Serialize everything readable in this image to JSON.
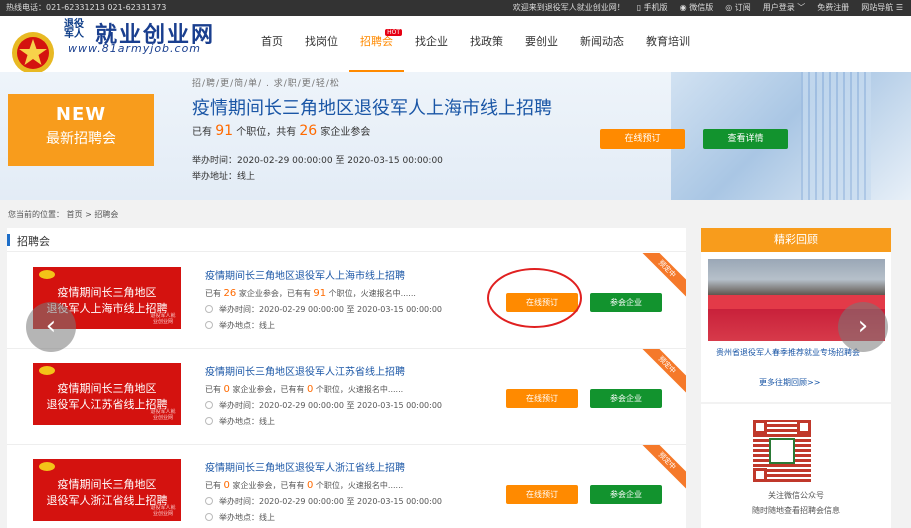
{
  "topbar": {
    "hotline": "热线电话：021-62331213 021-62331373",
    "welcome": "欢迎来到退役军人就业创业网！",
    "mobile": "手机版",
    "wechat": "微信版",
    "subscribe": "订阅",
    "login": "用户登录",
    "register": "免费注册",
    "sitenav": "网站导航"
  },
  "logo": {
    "line1": "退役军人",
    "line2": "就业创业网",
    "url": "www.81armyjob.com"
  },
  "nav": {
    "items": [
      "首页",
      "找岗位",
      "招聘会",
      "找企业",
      "找政策",
      "要创业",
      "新闻动态",
      "教育培训"
    ],
    "hot_badge": "HOT"
  },
  "banner": {
    "new_label": "NEW",
    "new_sub": "最新招聘会",
    "slogan": "招/聘/更/简/单/ . 求/职/更/轻/松",
    "title": "疫情期间长三角地区退役军人上海市线上招聘",
    "count_prefix": "已有",
    "positions": "91",
    "count_mid": "个职位，共有",
    "companies": "26",
    "count_suffix": "家企业参会",
    "time": "举办时间：2020-02-29 00:00:00 至 2020-03-15 00:00:00",
    "address": "举办地址：线上",
    "btn_book": "在线预订",
    "btn_detail": "查看详情"
  },
  "breadcrumb": "您当前的位置： 首页 > 招聘会",
  "section_title": "招聘会",
  "fairs": [
    {
      "thumb_l1": "疫情期间长三角地区",
      "thumb_l2": "退役军人上海市线上招聘",
      "thumb_mark": "退役军人就业创业网",
      "title": "疫情期间长三角地区退役军人上海市线上招聘",
      "p1": "已有 ",
      "n1": "26",
      "p2": " 家企业参会，已有有 ",
      "n2": "91",
      "p3": " 个职位，火速报名中......",
      "time": "举办时间：2020-02-29 00:00:00 至 2020-03-15 00:00:00",
      "addr": "举办地点：线上",
      "btn_book": "在线预订",
      "btn_join": "参会企业",
      "ribbon": "预定中"
    },
    {
      "thumb_l1": "疫情期间长三角地区",
      "thumb_l2": "退役军人江苏省线上招聘",
      "thumb_mark": "退役军人就业创业网",
      "title": "疫情期间长三角地区退役军人江苏省线上招聘",
      "p1": "已有 ",
      "n1": "0",
      "p2": " 家企业参会，已有有 ",
      "n2": "0",
      "p3": " 个职位，火速报名中......",
      "time": "举办时间：2020-02-29 00:00:00 至 2020-03-15 00:00:00",
      "addr": "举办地点：线上",
      "btn_book": "在线预订",
      "btn_join": "参会企业",
      "ribbon": "预定中"
    },
    {
      "thumb_l1": "疫情期间长三角地区",
      "thumb_l2": "退役军人浙江省线上招聘",
      "thumb_mark": "退役军人就业创业网",
      "title": "疫情期间长三角地区退役军人浙江省线上招聘",
      "p1": "已有 ",
      "n1": "0",
      "p2": " 家企业参会，已有有 ",
      "n2": "0",
      "p3": " 个职位，火速报名中......",
      "time": "举办时间：2020-02-29 00:00:00 至 2020-03-15 00:00:00",
      "addr": "举办地点：线上",
      "btn_book": "在线预订",
      "btn_join": "参会企业",
      "ribbon": "预定中"
    }
  ],
  "sidebar": {
    "title": "精彩回顾",
    "caption": "贵州省退役军人春季推荐就业专场招聘会",
    "more": "更多往期回顾>>",
    "qr_line1": "关注微信公众号",
    "qr_line2": "随时随地查看招聘会信息"
  },
  "arrows": {
    "left": "‹",
    "right": "›"
  },
  "colors": {
    "accent": "#ff8a00",
    "green": "#12932e",
    "link": "#1a56a6",
    "red": "#d4120f"
  }
}
